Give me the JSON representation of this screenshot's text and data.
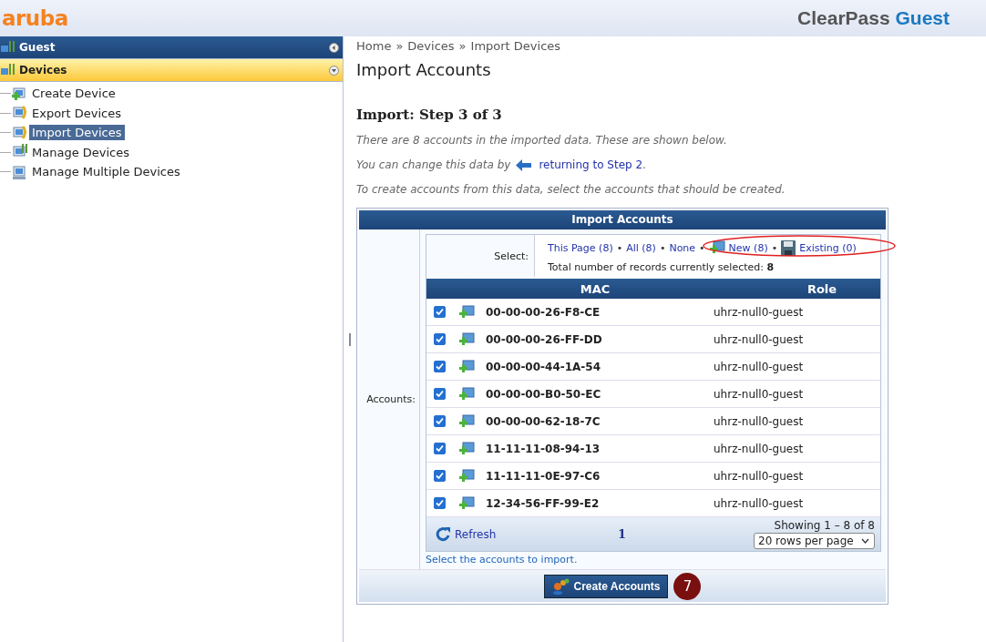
{
  "header": {
    "logo": "aruba",
    "product": "ClearPass",
    "edition": "Guest"
  },
  "sidebar": {
    "sections": [
      {
        "label": "Guest",
        "expanded": false,
        "selected": false
      },
      {
        "label": "Devices",
        "expanded": true,
        "selected": true,
        "items": [
          {
            "label": "Create Device",
            "selected": false,
            "kind": "create"
          },
          {
            "label": "Export Devices",
            "selected": false,
            "kind": "export"
          },
          {
            "label": "Import Devices",
            "selected": true,
            "kind": "import"
          },
          {
            "label": "Manage Devices",
            "selected": false,
            "kind": "manage"
          },
          {
            "label": "Manage Multiple Devices",
            "selected": false,
            "kind": "multiple"
          }
        ]
      }
    ]
  },
  "breadcrumb": [
    {
      "label": "Home"
    },
    {
      "label": "Devices",
      "sep": "»"
    },
    {
      "label": "Import Devices",
      "sep": "»"
    }
  ],
  "page_title": "Import Accounts",
  "step_heading": "Import: Step 3 of 3",
  "intro": "There are 8 accounts in the imported data. These are shown below.",
  "change_text": "You can change this data by",
  "change_link": "returning to Step 2",
  "change_end": ".",
  "instruction": "To create accounts from this data, select the accounts that should be created.",
  "panel": {
    "title": "Import Accounts",
    "field_label": "Accounts:",
    "select": {
      "label": "Select:",
      "links": [
        {
          "label": "This Page (8)",
          "kind": "plain"
        },
        {
          "label": "All (8)",
          "bullet": "•",
          "kind": "plain"
        },
        {
          "label": "None",
          "bullet": "•",
          "kind": "plain"
        },
        {
          "label": "New (8)",
          "bullet": "•",
          "kind": "new"
        },
        {
          "label": "Existing (0)",
          "bullet": "•",
          "kind": "existing"
        }
      ],
      "total_label": "Total number of records currently selected:",
      "total_value": "8"
    },
    "columns": [
      "MAC",
      "Role"
    ],
    "rows": [
      {
        "mac": "00-00-00-26-F8-CE",
        "role": "uhrz-null0-guest",
        "checked": true,
        "kind": "new"
      },
      {
        "mac": "00-00-00-26-FF-DD",
        "role": "uhrz-null0-guest",
        "checked": true,
        "kind": "new"
      },
      {
        "mac": "00-00-00-44-1A-54",
        "role": "uhrz-null0-guest",
        "checked": true,
        "kind": "new"
      },
      {
        "mac": "00-00-00-B0-50-EC",
        "role": "uhrz-null0-guest",
        "checked": true,
        "kind": "new"
      },
      {
        "mac": "00-00-00-62-18-7C",
        "role": "uhrz-null0-guest",
        "checked": true,
        "kind": "new"
      },
      {
        "mac": "11-11-11-08-94-13",
        "role": "uhrz-null0-guest",
        "checked": true,
        "kind": "new"
      },
      {
        "mac": "11-11-11-0E-97-C6",
        "role": "uhrz-null0-guest",
        "checked": true,
        "kind": "new"
      },
      {
        "mac": "12-34-56-FF-99-E2",
        "role": "uhrz-null0-guest",
        "checked": true,
        "kind": "new"
      }
    ],
    "footer": {
      "refresh": "Refresh",
      "page": "1",
      "showing": "Showing 1 – 8 of 8",
      "rows_per_page": "20 rows per page"
    },
    "hint": "Select the accounts to import.",
    "button": "Create Accounts",
    "step_badge": "7"
  }
}
